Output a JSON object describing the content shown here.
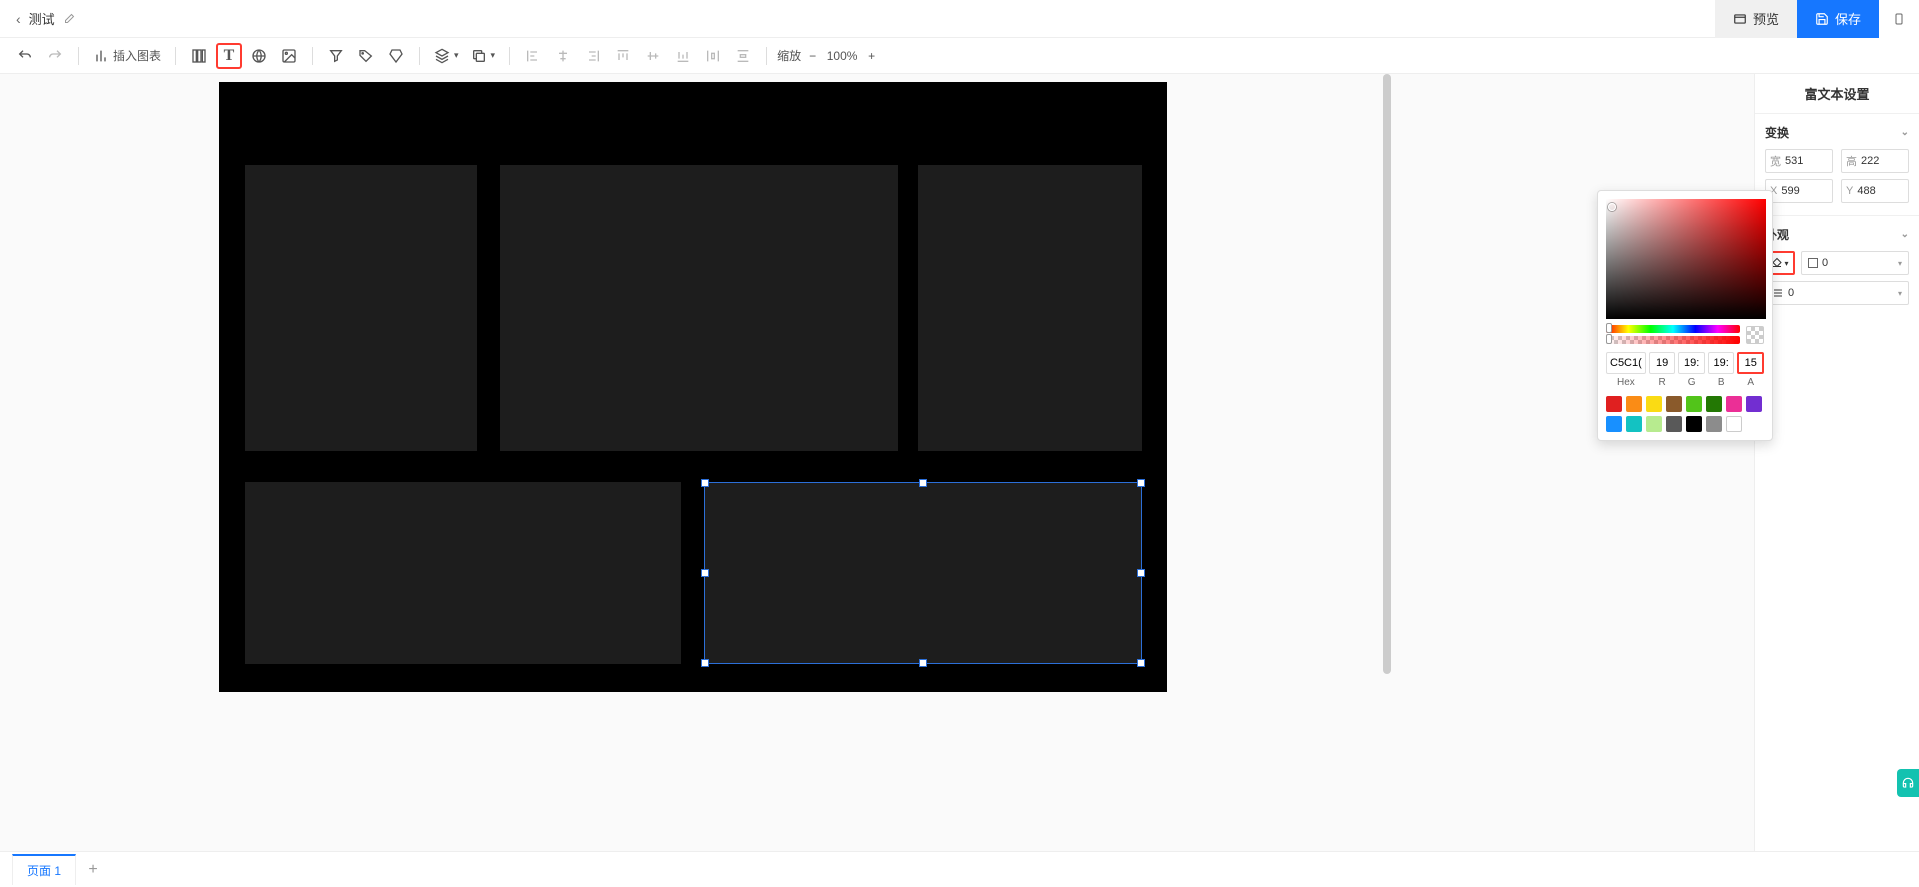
{
  "header": {
    "title": "测试",
    "preview_label": "预览",
    "save_label": "保存"
  },
  "toolbar": {
    "insert_chart_label": "插入图表",
    "zoom_label": "缩放",
    "zoom_value": "100%"
  },
  "right_panel": {
    "title": "富文本设置",
    "transform": {
      "label": "变换",
      "width_label": "宽",
      "width": "531",
      "height_label": "高",
      "height": "222",
      "x_label": "X",
      "x": "599",
      "y_label": "Y",
      "y": "488"
    },
    "appearance": {
      "label": "外观",
      "border_value": "0",
      "line_value": "0"
    }
  },
  "color_picker": {
    "hex_label": "Hex",
    "r_label": "R",
    "g_label": "G",
    "b_label": "B",
    "a_label": "A",
    "hex": "C5C1(",
    "r": "19",
    "g": "19:",
    "b": "19:",
    "a": "15",
    "swatches": [
      "#e02020",
      "#fa8c16",
      "#fadb14",
      "#8a5a2b",
      "#52c41a",
      "#237804",
      "#eb2f96",
      "#722ed1",
      "#1890ff",
      "#13c2c2",
      "#b7eb8f",
      "#595959",
      "#000000",
      "#8c8c8c"
    ]
  },
  "tabs": {
    "page1": "页面 1"
  }
}
